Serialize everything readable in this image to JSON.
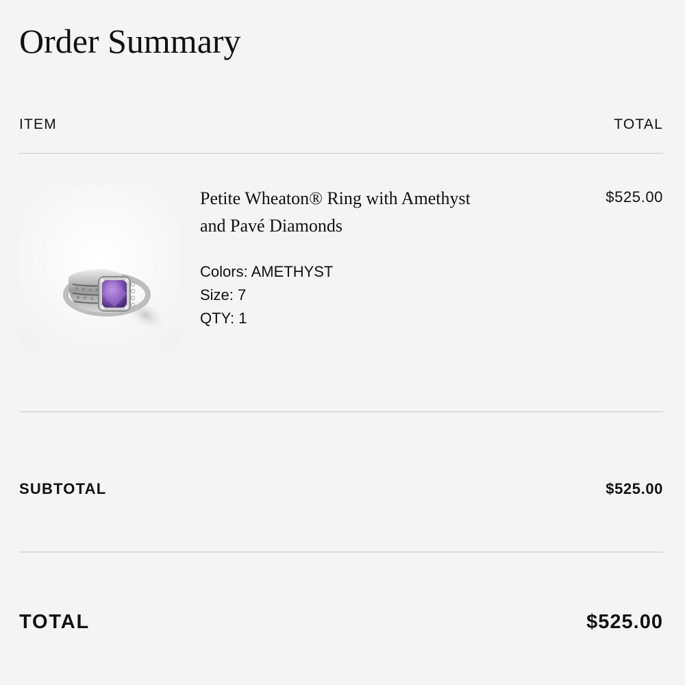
{
  "page": {
    "title": "Order Summary"
  },
  "columns": {
    "item": "ITEM",
    "total": "TOTAL"
  },
  "line_item": {
    "name": "Petite Wheaton® Ring with Amethyst and Pavé Diamonds",
    "attributes": [
      "Colors: AMETHYST",
      "Size: 7",
      "QTY: 1"
    ],
    "price": "$525.00",
    "image_icon": "ring-product-image",
    "stone_color": "#8a5cc0"
  },
  "summary": {
    "subtotal_label": "SUBTOTAL",
    "subtotal_value": "$525.00",
    "total_label": "TOTAL",
    "total_value": "$525.00"
  },
  "colors": {
    "background": "#f4f4f4",
    "divider": "#dcdcdc",
    "text": "#111111"
  }
}
